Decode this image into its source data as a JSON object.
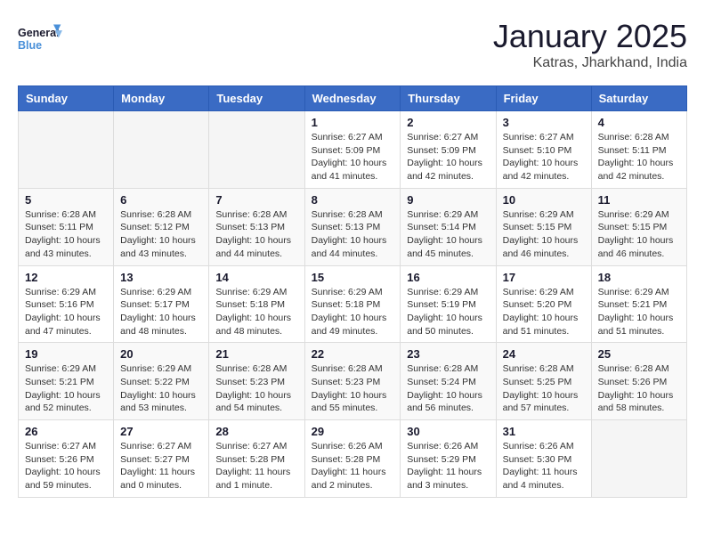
{
  "logo": {
    "line1": "General",
    "line2": "Blue"
  },
  "title": "January 2025",
  "subtitle": "Katras, Jharkhand, India",
  "weekdays": [
    "Sunday",
    "Monday",
    "Tuesday",
    "Wednesday",
    "Thursday",
    "Friday",
    "Saturday"
  ],
  "weeks": [
    [
      {
        "day": "",
        "info": ""
      },
      {
        "day": "",
        "info": ""
      },
      {
        "day": "",
        "info": ""
      },
      {
        "day": "1",
        "info": "Sunrise: 6:27 AM\nSunset: 5:09 PM\nDaylight: 10 hours\nand 41 minutes."
      },
      {
        "day": "2",
        "info": "Sunrise: 6:27 AM\nSunset: 5:09 PM\nDaylight: 10 hours\nand 42 minutes."
      },
      {
        "day": "3",
        "info": "Sunrise: 6:27 AM\nSunset: 5:10 PM\nDaylight: 10 hours\nand 42 minutes."
      },
      {
        "day": "4",
        "info": "Sunrise: 6:28 AM\nSunset: 5:11 PM\nDaylight: 10 hours\nand 42 minutes."
      }
    ],
    [
      {
        "day": "5",
        "info": "Sunrise: 6:28 AM\nSunset: 5:11 PM\nDaylight: 10 hours\nand 43 minutes."
      },
      {
        "day": "6",
        "info": "Sunrise: 6:28 AM\nSunset: 5:12 PM\nDaylight: 10 hours\nand 43 minutes."
      },
      {
        "day": "7",
        "info": "Sunrise: 6:28 AM\nSunset: 5:13 PM\nDaylight: 10 hours\nand 44 minutes."
      },
      {
        "day": "8",
        "info": "Sunrise: 6:28 AM\nSunset: 5:13 PM\nDaylight: 10 hours\nand 44 minutes."
      },
      {
        "day": "9",
        "info": "Sunrise: 6:29 AM\nSunset: 5:14 PM\nDaylight: 10 hours\nand 45 minutes."
      },
      {
        "day": "10",
        "info": "Sunrise: 6:29 AM\nSunset: 5:15 PM\nDaylight: 10 hours\nand 46 minutes."
      },
      {
        "day": "11",
        "info": "Sunrise: 6:29 AM\nSunset: 5:15 PM\nDaylight: 10 hours\nand 46 minutes."
      }
    ],
    [
      {
        "day": "12",
        "info": "Sunrise: 6:29 AM\nSunset: 5:16 PM\nDaylight: 10 hours\nand 47 minutes."
      },
      {
        "day": "13",
        "info": "Sunrise: 6:29 AM\nSunset: 5:17 PM\nDaylight: 10 hours\nand 48 minutes."
      },
      {
        "day": "14",
        "info": "Sunrise: 6:29 AM\nSunset: 5:18 PM\nDaylight: 10 hours\nand 48 minutes."
      },
      {
        "day": "15",
        "info": "Sunrise: 6:29 AM\nSunset: 5:18 PM\nDaylight: 10 hours\nand 49 minutes."
      },
      {
        "day": "16",
        "info": "Sunrise: 6:29 AM\nSunset: 5:19 PM\nDaylight: 10 hours\nand 50 minutes."
      },
      {
        "day": "17",
        "info": "Sunrise: 6:29 AM\nSunset: 5:20 PM\nDaylight: 10 hours\nand 51 minutes."
      },
      {
        "day": "18",
        "info": "Sunrise: 6:29 AM\nSunset: 5:21 PM\nDaylight: 10 hours\nand 51 minutes."
      }
    ],
    [
      {
        "day": "19",
        "info": "Sunrise: 6:29 AM\nSunset: 5:21 PM\nDaylight: 10 hours\nand 52 minutes."
      },
      {
        "day": "20",
        "info": "Sunrise: 6:29 AM\nSunset: 5:22 PM\nDaylight: 10 hours\nand 53 minutes."
      },
      {
        "day": "21",
        "info": "Sunrise: 6:28 AM\nSunset: 5:23 PM\nDaylight: 10 hours\nand 54 minutes."
      },
      {
        "day": "22",
        "info": "Sunrise: 6:28 AM\nSunset: 5:23 PM\nDaylight: 10 hours\nand 55 minutes."
      },
      {
        "day": "23",
        "info": "Sunrise: 6:28 AM\nSunset: 5:24 PM\nDaylight: 10 hours\nand 56 minutes."
      },
      {
        "day": "24",
        "info": "Sunrise: 6:28 AM\nSunset: 5:25 PM\nDaylight: 10 hours\nand 57 minutes."
      },
      {
        "day": "25",
        "info": "Sunrise: 6:28 AM\nSunset: 5:26 PM\nDaylight: 10 hours\nand 58 minutes."
      }
    ],
    [
      {
        "day": "26",
        "info": "Sunrise: 6:27 AM\nSunset: 5:26 PM\nDaylight: 10 hours\nand 59 minutes."
      },
      {
        "day": "27",
        "info": "Sunrise: 6:27 AM\nSunset: 5:27 PM\nDaylight: 11 hours\nand 0 minutes."
      },
      {
        "day": "28",
        "info": "Sunrise: 6:27 AM\nSunset: 5:28 PM\nDaylight: 11 hours\nand 1 minute."
      },
      {
        "day": "29",
        "info": "Sunrise: 6:26 AM\nSunset: 5:28 PM\nDaylight: 11 hours\nand 2 minutes."
      },
      {
        "day": "30",
        "info": "Sunrise: 6:26 AM\nSunset: 5:29 PM\nDaylight: 11 hours\nand 3 minutes."
      },
      {
        "day": "31",
        "info": "Sunrise: 6:26 AM\nSunset: 5:30 PM\nDaylight: 11 hours\nand 4 minutes."
      },
      {
        "day": "",
        "info": ""
      }
    ]
  ]
}
